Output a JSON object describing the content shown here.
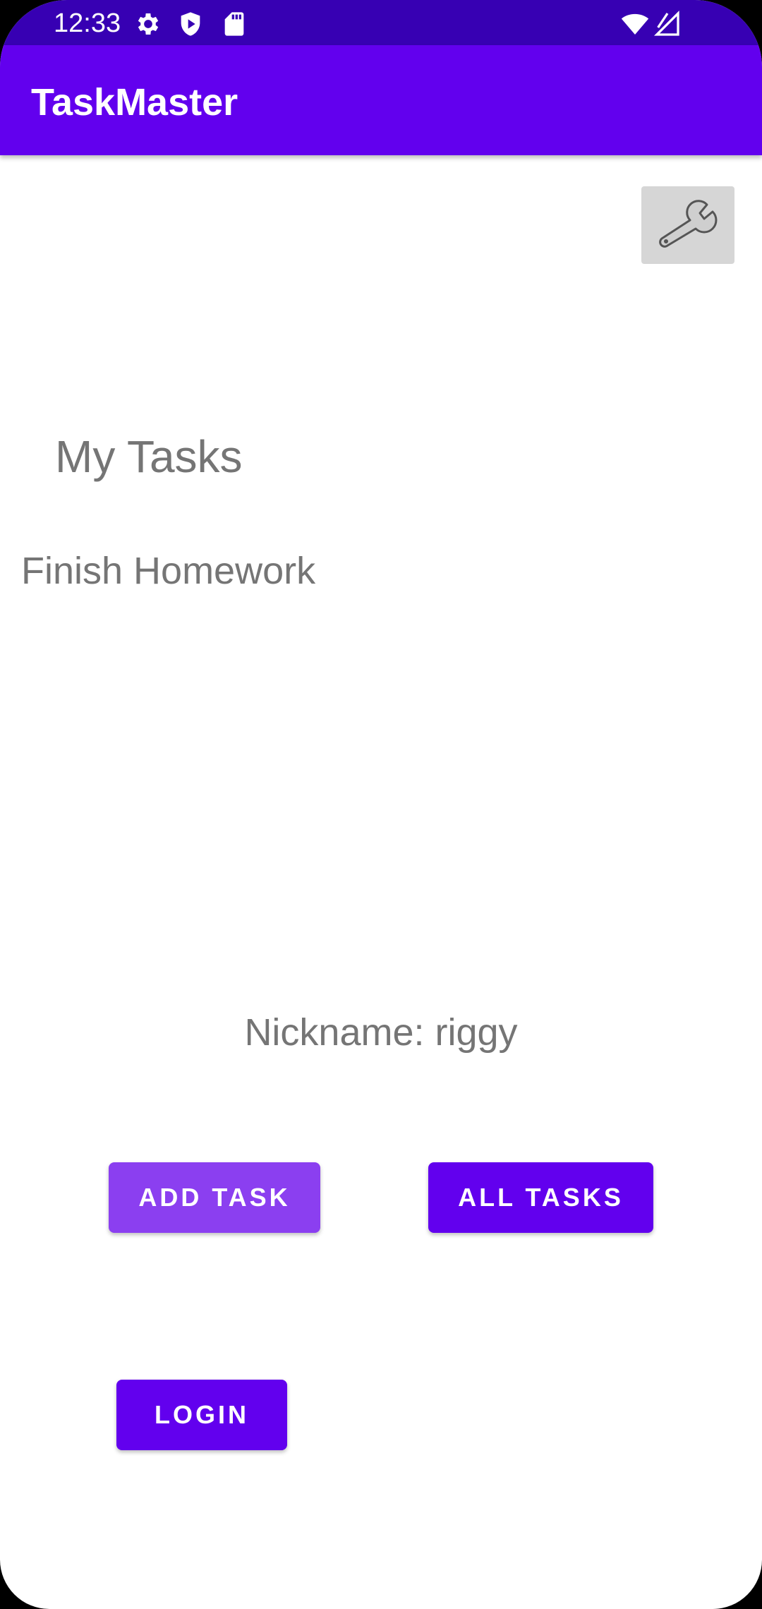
{
  "status_bar": {
    "time": "12:33",
    "icons": [
      "gear-icon",
      "shield-play-icon",
      "sd-card-icon",
      "wifi-icon",
      "signal-icon"
    ]
  },
  "app_bar": {
    "title": "TaskMaster",
    "color": "#6200ee"
  },
  "settings_button": {
    "icon": "wrench-icon"
  },
  "main": {
    "heading": "My Tasks",
    "tasks": [
      "Finish Homework"
    ],
    "nickname": "Nickname: riggy"
  },
  "buttons": {
    "add_task": "ADD TASK",
    "all_tasks": "ALL TASKS",
    "login": "LOGIN"
  },
  "colors": {
    "primary": "#6200ee",
    "primary_dark": "#3700b3",
    "add_button": "#8b3ff0",
    "text_secondary": "#757575"
  }
}
